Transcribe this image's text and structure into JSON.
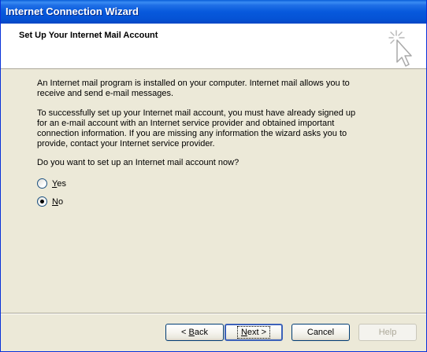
{
  "window": {
    "title": "Internet Connection Wizard"
  },
  "header": {
    "title": "Set Up Your Internet Mail Account",
    "icon": "mouse-cursor-sparkle-icon"
  },
  "body": {
    "paragraph1": "An Internet mail program is installed on your computer. Internet mail allows you to receive and send e-mail messages.",
    "paragraph2": "To successfully set up your Internet mail account, you must have already signed up for an e-mail account with an Internet service provider and obtained important connection information. If you are missing any information the wizard asks you to provide, contact your Internet service provider.",
    "question": "Do you want to set up an Internet mail account now?"
  },
  "options": {
    "yes_label_first": "Y",
    "yes_label_rest": "es",
    "no_label_first": "N",
    "no_label_rest": "o",
    "selected": "No"
  },
  "buttons": {
    "back_prefix": "< ",
    "back_first": "B",
    "back_rest": "ack",
    "next_first": "N",
    "next_rest": "ext >",
    "cancel": "Cancel",
    "help": "Help"
  },
  "colors": {
    "titlebar": "#0553d5",
    "face": "#ece9d8",
    "radio_dot": "#000000"
  }
}
